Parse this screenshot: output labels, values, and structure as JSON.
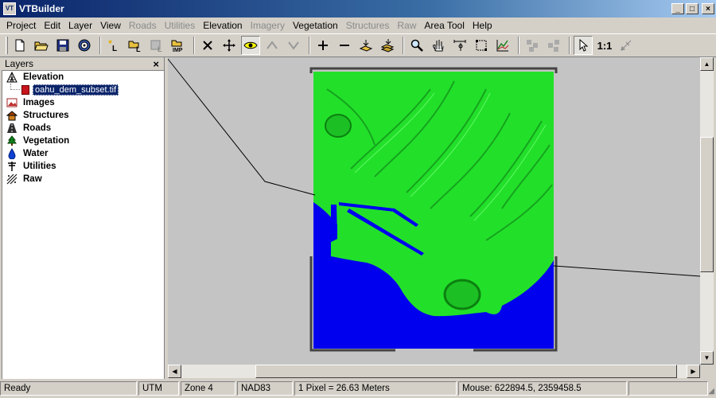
{
  "window": {
    "title": "VTBuilder",
    "app_icon_text": "VT"
  },
  "menu": [
    {
      "label": "Project",
      "enabled": true
    },
    {
      "label": "Edit",
      "enabled": true
    },
    {
      "label": "Layer",
      "enabled": true
    },
    {
      "label": "View",
      "enabled": true
    },
    {
      "label": "Roads",
      "enabled": false
    },
    {
      "label": "Utilities",
      "enabled": false
    },
    {
      "label": "Elevation",
      "enabled": true
    },
    {
      "label": "Imagery",
      "enabled": false
    },
    {
      "label": "Vegetation",
      "enabled": true
    },
    {
      "label": "Structures",
      "enabled": false
    },
    {
      "label": "Raw",
      "enabled": false
    },
    {
      "label": "Area Tool",
      "enabled": true
    },
    {
      "label": "Help",
      "enabled": true
    }
  ],
  "toolbar": {
    "zoom_one_to_one_label": "1:1",
    "buttons": [
      "new-project-icon",
      "open-project-icon",
      "save-project-icon",
      "options-gear-icon",
      "new-layer-icon",
      "open-layer-icon",
      "save-layer-icon",
      "import-icon",
      "delete-icon",
      "pan-move-icon",
      "show-layer-eye-icon",
      "layer-up-icon",
      "layer-down-icon",
      "zoom-in-icon",
      "zoom-out-icon",
      "zoom-all-icon",
      "zoom-layer-icon",
      "magnify-icon",
      "hand-pan-icon",
      "distance-icon",
      "area-box-icon",
      "profile-icon",
      "tile-disabled-icon",
      "tile2-disabled-icon",
      "select-arrow-icon",
      "zoom-1to1",
      "instance-icon"
    ]
  },
  "layers_panel": {
    "title": "Layers",
    "close_glyph": "×",
    "layers": [
      {
        "name": "Elevation",
        "icon": "elevation-grid-icon"
      },
      {
        "name": "Images",
        "icon": "images-icon"
      },
      {
        "name": "Structures",
        "icon": "structures-house-icon"
      },
      {
        "name": "Roads",
        "icon": "roads-icon"
      },
      {
        "name": "Vegetation",
        "icon": "tree-icon"
      },
      {
        "name": "Water",
        "icon": "water-drop-icon"
      },
      {
        "name": "Utilities",
        "icon": "utility-pole-icon"
      },
      {
        "name": "Raw",
        "icon": "raw-points-icon"
      }
    ],
    "elevation_file": "oahu_dem_subset.tif"
  },
  "colors": {
    "land": "#22e02a",
    "water": "#0000ee",
    "map_bg": "#c4c4c4",
    "selection": "#0a246a"
  },
  "status": {
    "ready": "Ready",
    "projection": "UTM",
    "zone": "Zone 4",
    "datum": "NAD83",
    "scale": "1 Pixel = 26.63 Meters",
    "mouse": "Mouse: 622894.5, 2359458.5"
  }
}
